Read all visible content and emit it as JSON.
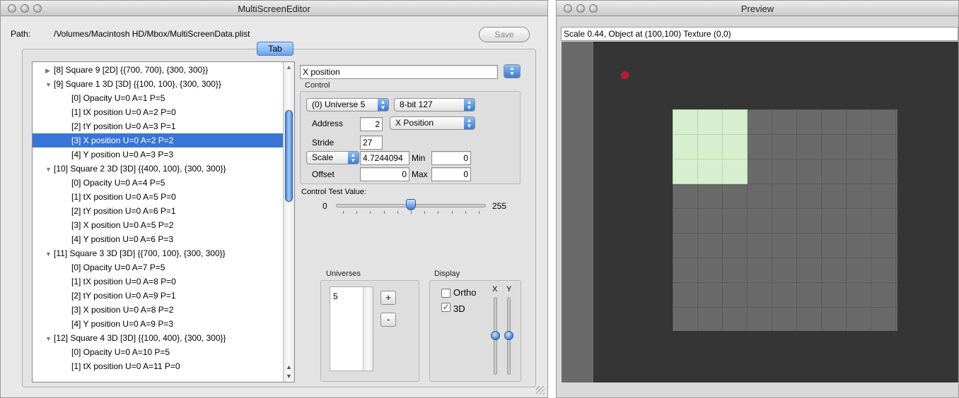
{
  "editor": {
    "title": "MultiScreenEditor",
    "path_label": "Path:",
    "path_value": "/Volumes/Macintosh HD/Mbox/MultiScreenData.plist",
    "save_label": "Save",
    "tab_label": "Tab",
    "outline_rows": [
      {
        "text": "[8] Square 9  [2D] {{700, 700}, {300, 300}}",
        "level": 0,
        "disclosure": "collapsed",
        "selected": false
      },
      {
        "text": "[9] Square 1 3D  [3D] {{100, 100}, {300, 300}}",
        "level": 0,
        "disclosure": "expanded",
        "selected": false
      },
      {
        "text": "[0] Opacity U=0 A=1 P=5",
        "level": 1,
        "disclosure": "none",
        "selected": false
      },
      {
        "text": "[1] tX position U=0 A=2 P=0",
        "level": 1,
        "disclosure": "none",
        "selected": false
      },
      {
        "text": "[2] tY position U=0 A=3 P=1",
        "level": 1,
        "disclosure": "none",
        "selected": false
      },
      {
        "text": "[3] X position U=0 A=2 P=2",
        "level": 1,
        "disclosure": "none",
        "selected": true
      },
      {
        "text": "[4] Y position U=0 A=3 P=3",
        "level": 1,
        "disclosure": "none",
        "selected": false
      },
      {
        "text": "[10] Square 2 3D  [3D] {{400, 100}, {300, 300}}",
        "level": 0,
        "disclosure": "expanded",
        "selected": false
      },
      {
        "text": "[0] Opacity U=0 A=4 P=5",
        "level": 1,
        "disclosure": "none",
        "selected": false
      },
      {
        "text": "[1] tX position U=0 A=5 P=0",
        "level": 1,
        "disclosure": "none",
        "selected": false
      },
      {
        "text": "[2] tY position U=0 A=6 P=1",
        "level": 1,
        "disclosure": "none",
        "selected": false
      },
      {
        "text": "[3] X position U=0 A=5 P=2",
        "level": 1,
        "disclosure": "none",
        "selected": false
      },
      {
        "text": "[4] Y position U=0 A=6 P=3",
        "level": 1,
        "disclosure": "none",
        "selected": false
      },
      {
        "text": "[11] Square 3 3D  [3D] {{700, 100}, {300, 300}}",
        "level": 0,
        "disclosure": "expanded",
        "selected": false
      },
      {
        "text": "[0] Opacity U=0 A=7 P=5",
        "level": 1,
        "disclosure": "none",
        "selected": false
      },
      {
        "text": "[1] tX position U=0 A=8 P=0",
        "level": 1,
        "disclosure": "none",
        "selected": false
      },
      {
        "text": "[2] tY position U=0 A=9 P=1",
        "level": 1,
        "disclosure": "none",
        "selected": false
      },
      {
        "text": "[3] X position U=0 A=8 P=2",
        "level": 1,
        "disclosure": "none",
        "selected": false
      },
      {
        "text": "[4] Y position U=0 A=9 P=3",
        "level": 1,
        "disclosure": "none",
        "selected": false
      },
      {
        "text": "[12] Square 4 3D  [3D] {{100, 400}, {300, 300}}",
        "level": 0,
        "disclosure": "expanded",
        "selected": false
      },
      {
        "text": "[0] Opacity U=0 A=10 P=5",
        "level": 1,
        "disclosure": "none",
        "selected": false
      },
      {
        "text": "[1] tX position U=0 A=11 P=0",
        "level": 1,
        "disclosure": "none",
        "selected": false
      }
    ],
    "detail": {
      "name_value": "X position",
      "control_title": "Control",
      "universe_popup": "(0) Universe 5",
      "bits_popup": "8-bit 127",
      "address_label": "Address",
      "address_value": "2",
      "property_popup": "X Position",
      "stride_label": "Stride",
      "stride_value": "27",
      "scale_popup": "Scale",
      "scale_value": "4.7244094",
      "min_label": "Min",
      "min_value": "0",
      "offset_label": "Offset",
      "offset_value": "0",
      "max_label": "Max",
      "max_value": "0",
      "test_label": "Control Test Value:",
      "slider_min": "0",
      "slider_max": "255",
      "slider_value": 127,
      "universes_title": "Universes",
      "universes_list": [
        "5"
      ],
      "add_label": "+",
      "remove_label": "-",
      "display_title": "Display",
      "ortho_label": "Ortho",
      "ortho_checked": false,
      "threed_label": "3D",
      "threed_checked": true,
      "x_label": "X",
      "y_label": "Y"
    }
  },
  "preview": {
    "title": "Preview",
    "info": "Scale 0.44, Object at (100,100) Texture (0,0)"
  },
  "colors": {
    "selection": "#3875d7",
    "highlight_square": "#d6f0cf",
    "canvas": "#353535",
    "marker": "#d3102a"
  }
}
